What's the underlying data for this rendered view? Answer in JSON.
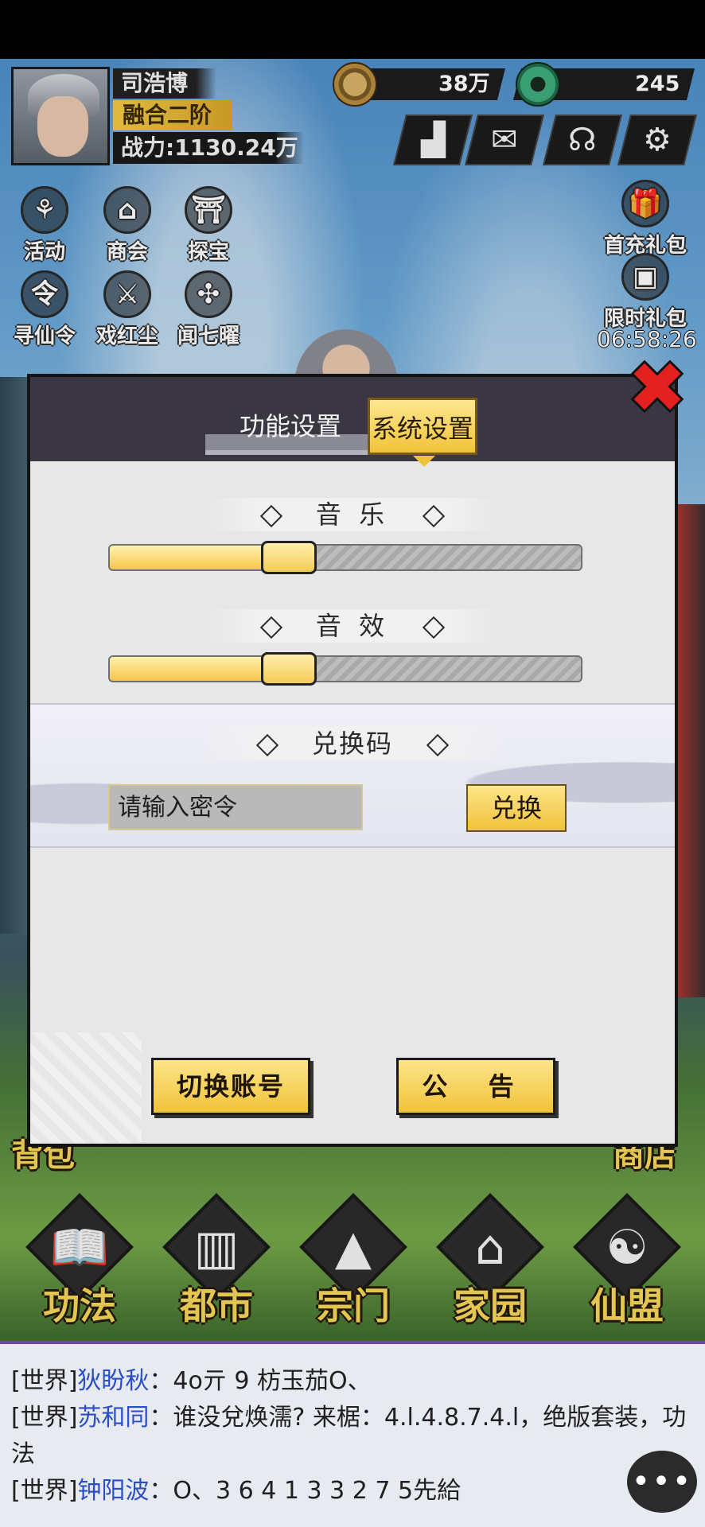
{
  "player": {
    "name": "司浩博",
    "rank": "融合二阶",
    "power": "战力:1130.24万"
  },
  "currencies": {
    "coins": "38万",
    "jade": "245"
  },
  "hud_buttons": [
    {
      "icon": "podium-icon",
      "glyph": "▟"
    },
    {
      "icon": "mail-icon",
      "glyph": "✉"
    },
    {
      "icon": "headset-icon",
      "glyph": "☊"
    },
    {
      "icon": "gear-icon",
      "glyph": "⚙"
    }
  ],
  "side_left": [
    {
      "label": "活动",
      "icon": "balloon-icon",
      "glyph": "⚘"
    },
    {
      "label": "商会",
      "icon": "lantern-icon",
      "glyph": "⌂"
    },
    {
      "label": "探宝",
      "icon": "gate-icon",
      "glyph": "⛩"
    },
    {
      "label": "寻仙令",
      "icon": "token-icon",
      "glyph": "令"
    },
    {
      "label": "戏红尘",
      "icon": "sword-icon",
      "glyph": "⚔"
    },
    {
      "label": "闻七曜",
      "icon": "pinwheel-icon",
      "glyph": "✣"
    }
  ],
  "side_right": [
    {
      "label": "首充礼包",
      "icon": "gift-icon",
      "glyph": "🎁"
    },
    {
      "label": "限时礼包",
      "icon": "gift-box-icon",
      "glyph": "▣"
    }
  ],
  "countdown": "06:58:26",
  "modal": {
    "tabs": {
      "function": "功能设置",
      "system": "系统设置"
    },
    "music_label": "音 乐",
    "music_level": 0.38,
    "sfx_label": "音 效",
    "sfx_level": 0.38,
    "redeem_title": "兑换码",
    "redeem_placeholder": "请输入密令",
    "redeem_button": "兑换",
    "switch_account": "切换账号",
    "notice": "公 告"
  },
  "bottom_nav": [
    {
      "label": "功法",
      "icon": "book-icon",
      "glyph": "📖"
    },
    {
      "label": "都市",
      "icon": "building-icon",
      "glyph": "▥"
    },
    {
      "label": "宗门",
      "icon": "mountain-icon",
      "glyph": "▲"
    },
    {
      "label": "家园",
      "icon": "house-icon",
      "glyph": "⌂"
    },
    {
      "label": "仙盟",
      "icon": "yinyang-icon",
      "glyph": "☯"
    }
  ],
  "partial_labels": {
    "bag": "背包",
    "shop": "商店"
  },
  "chat": [
    {
      "channel": "[世界]",
      "name": "狄盼秋",
      "text": "：4o亓 9 枋玉茄O、"
    },
    {
      "channel": "[世界]",
      "name": "苏和同",
      "text": "：谁没兌焕濡? 来椐：4.l.4.8.7.4.l，绝版套装，功法"
    },
    {
      "channel": "[世界]",
      "name": "钟阳波",
      "text": "：O、3 6 4 1 3 3 2 7 5先給"
    }
  ],
  "chat_bubble": "•••"
}
